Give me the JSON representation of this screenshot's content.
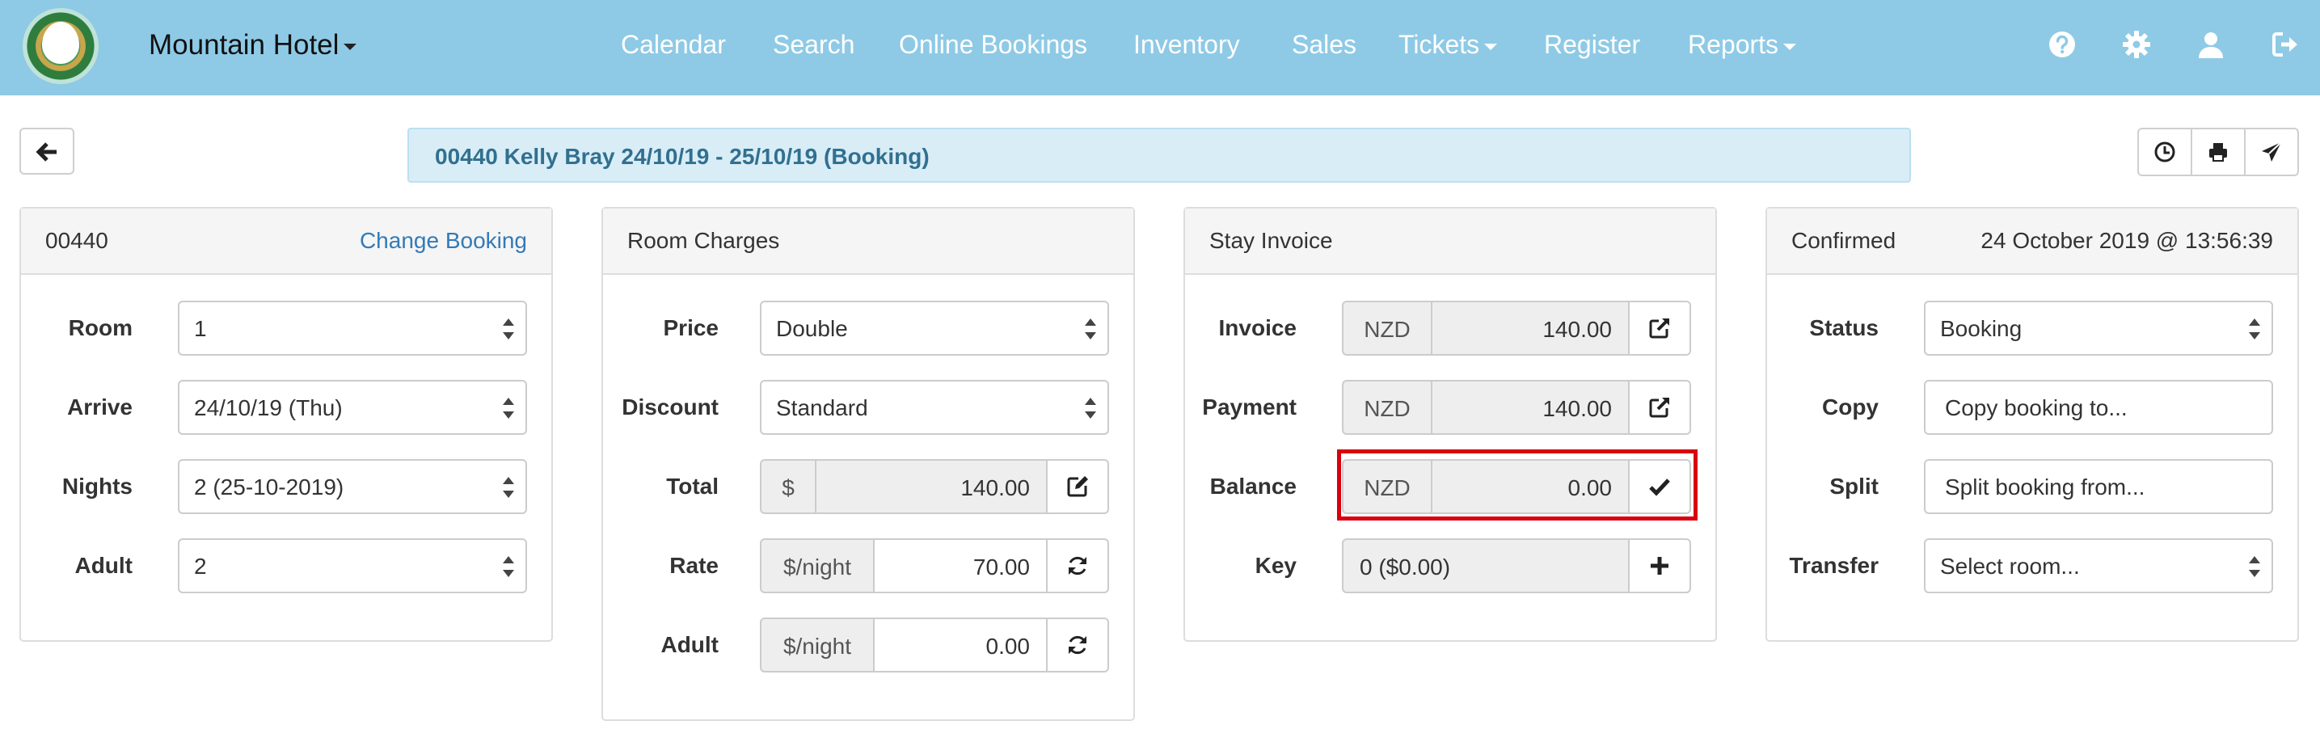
{
  "navbar": {
    "brand": "Mountain Hotel",
    "items": [
      {
        "label": "Calendar"
      },
      {
        "label": "Search"
      },
      {
        "label": "Online Bookings"
      },
      {
        "label": "Inventory"
      },
      {
        "label": "Sales"
      },
      {
        "label": "Tickets"
      },
      {
        "label": "Register"
      },
      {
        "label": "Reports"
      }
    ],
    "icons": [
      "help-icon",
      "gear-icon",
      "user-icon",
      "logout-icon"
    ]
  },
  "booking_bar": {
    "text": "00440  Kelly Bray  24/10/19 - 25/10/19  (Booking)"
  },
  "booking_panel": {
    "number": "00440",
    "change_link": "Change Booking",
    "room_label": "Room",
    "room_value": "1",
    "arrive_label": "Arrive",
    "arrive_value": "24/10/19  (Thu)",
    "nights_label": "Nights",
    "nights_value": "2  (25-10-2019)",
    "adult_label": "Adult",
    "adult_value": "2"
  },
  "room_charges": {
    "title": "Room Charges",
    "price_label": "Price",
    "price_value": "Double",
    "discount_label": "Discount",
    "discount_value": "Standard",
    "total_label": "Total",
    "total_currency": "$",
    "total_value": "140.00",
    "rate_label": "Rate",
    "rate_unit": "$/night",
    "rate_value": "70.00",
    "adult_label": "Adult",
    "adult_unit": "$/night",
    "adult_value": "0.00"
  },
  "stay_invoice": {
    "title": "Stay Invoice",
    "invoice_label": "Invoice",
    "invoice_currency": "NZD",
    "invoice_value": "140.00",
    "payment_label": "Payment",
    "payment_currency": "NZD",
    "payment_value": "140.00",
    "balance_label": "Balance",
    "balance_currency": "NZD",
    "balance_value": "0.00",
    "key_label": "Key",
    "key_value": "0 ($0.00)"
  },
  "status_panel": {
    "state": "Confirmed",
    "timestamp": "24 October 2019 @ 13:56:39",
    "status_label": "Status",
    "status_value": "Booking",
    "copy_label": "Copy",
    "copy_value": "Copy booking to...",
    "split_label": "Split",
    "split_value": "Split booking from...",
    "transfer_label": "Transfer",
    "transfer_value": "Select room..."
  },
  "colors": {
    "navbar": "#8ecae6",
    "booking_bar_bg": "#d9edf7",
    "booking_bar_text": "#31708f",
    "link": "#337ab7",
    "highlight": "#d9000f"
  }
}
